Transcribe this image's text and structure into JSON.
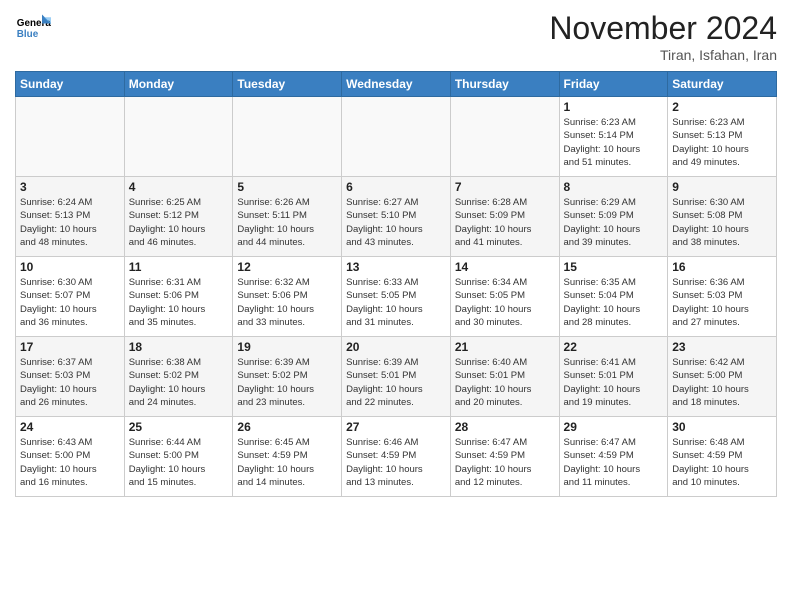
{
  "header": {
    "logo_line1": "General",
    "logo_line2": "Blue",
    "month_title": "November 2024",
    "location": "Tiran, Isfahan, Iran"
  },
  "weekdays": [
    "Sunday",
    "Monday",
    "Tuesday",
    "Wednesday",
    "Thursday",
    "Friday",
    "Saturday"
  ],
  "weeks": [
    [
      {
        "day": "",
        "info": ""
      },
      {
        "day": "",
        "info": ""
      },
      {
        "day": "",
        "info": ""
      },
      {
        "day": "",
        "info": ""
      },
      {
        "day": "",
        "info": ""
      },
      {
        "day": "1",
        "info": "Sunrise: 6:23 AM\nSunset: 5:14 PM\nDaylight: 10 hours\nand 51 minutes."
      },
      {
        "day": "2",
        "info": "Sunrise: 6:23 AM\nSunset: 5:13 PM\nDaylight: 10 hours\nand 49 minutes."
      }
    ],
    [
      {
        "day": "3",
        "info": "Sunrise: 6:24 AM\nSunset: 5:13 PM\nDaylight: 10 hours\nand 48 minutes."
      },
      {
        "day": "4",
        "info": "Sunrise: 6:25 AM\nSunset: 5:12 PM\nDaylight: 10 hours\nand 46 minutes."
      },
      {
        "day": "5",
        "info": "Sunrise: 6:26 AM\nSunset: 5:11 PM\nDaylight: 10 hours\nand 44 minutes."
      },
      {
        "day": "6",
        "info": "Sunrise: 6:27 AM\nSunset: 5:10 PM\nDaylight: 10 hours\nand 43 minutes."
      },
      {
        "day": "7",
        "info": "Sunrise: 6:28 AM\nSunset: 5:09 PM\nDaylight: 10 hours\nand 41 minutes."
      },
      {
        "day": "8",
        "info": "Sunrise: 6:29 AM\nSunset: 5:09 PM\nDaylight: 10 hours\nand 39 minutes."
      },
      {
        "day": "9",
        "info": "Sunrise: 6:30 AM\nSunset: 5:08 PM\nDaylight: 10 hours\nand 38 minutes."
      }
    ],
    [
      {
        "day": "10",
        "info": "Sunrise: 6:30 AM\nSunset: 5:07 PM\nDaylight: 10 hours\nand 36 minutes."
      },
      {
        "day": "11",
        "info": "Sunrise: 6:31 AM\nSunset: 5:06 PM\nDaylight: 10 hours\nand 35 minutes."
      },
      {
        "day": "12",
        "info": "Sunrise: 6:32 AM\nSunset: 5:06 PM\nDaylight: 10 hours\nand 33 minutes."
      },
      {
        "day": "13",
        "info": "Sunrise: 6:33 AM\nSunset: 5:05 PM\nDaylight: 10 hours\nand 31 minutes."
      },
      {
        "day": "14",
        "info": "Sunrise: 6:34 AM\nSunset: 5:05 PM\nDaylight: 10 hours\nand 30 minutes."
      },
      {
        "day": "15",
        "info": "Sunrise: 6:35 AM\nSunset: 5:04 PM\nDaylight: 10 hours\nand 28 minutes."
      },
      {
        "day": "16",
        "info": "Sunrise: 6:36 AM\nSunset: 5:03 PM\nDaylight: 10 hours\nand 27 minutes."
      }
    ],
    [
      {
        "day": "17",
        "info": "Sunrise: 6:37 AM\nSunset: 5:03 PM\nDaylight: 10 hours\nand 26 minutes."
      },
      {
        "day": "18",
        "info": "Sunrise: 6:38 AM\nSunset: 5:02 PM\nDaylight: 10 hours\nand 24 minutes."
      },
      {
        "day": "19",
        "info": "Sunrise: 6:39 AM\nSunset: 5:02 PM\nDaylight: 10 hours\nand 23 minutes."
      },
      {
        "day": "20",
        "info": "Sunrise: 6:39 AM\nSunset: 5:01 PM\nDaylight: 10 hours\nand 22 minutes."
      },
      {
        "day": "21",
        "info": "Sunrise: 6:40 AM\nSunset: 5:01 PM\nDaylight: 10 hours\nand 20 minutes."
      },
      {
        "day": "22",
        "info": "Sunrise: 6:41 AM\nSunset: 5:01 PM\nDaylight: 10 hours\nand 19 minutes."
      },
      {
        "day": "23",
        "info": "Sunrise: 6:42 AM\nSunset: 5:00 PM\nDaylight: 10 hours\nand 18 minutes."
      }
    ],
    [
      {
        "day": "24",
        "info": "Sunrise: 6:43 AM\nSunset: 5:00 PM\nDaylight: 10 hours\nand 16 minutes."
      },
      {
        "day": "25",
        "info": "Sunrise: 6:44 AM\nSunset: 5:00 PM\nDaylight: 10 hours\nand 15 minutes."
      },
      {
        "day": "26",
        "info": "Sunrise: 6:45 AM\nSunset: 4:59 PM\nDaylight: 10 hours\nand 14 minutes."
      },
      {
        "day": "27",
        "info": "Sunrise: 6:46 AM\nSunset: 4:59 PM\nDaylight: 10 hours\nand 13 minutes."
      },
      {
        "day": "28",
        "info": "Sunrise: 6:47 AM\nSunset: 4:59 PM\nDaylight: 10 hours\nand 12 minutes."
      },
      {
        "day": "29",
        "info": "Sunrise: 6:47 AM\nSunset: 4:59 PM\nDaylight: 10 hours\nand 11 minutes."
      },
      {
        "day": "30",
        "info": "Sunrise: 6:48 AM\nSunset: 4:59 PM\nDaylight: 10 hours\nand 10 minutes."
      }
    ]
  ]
}
